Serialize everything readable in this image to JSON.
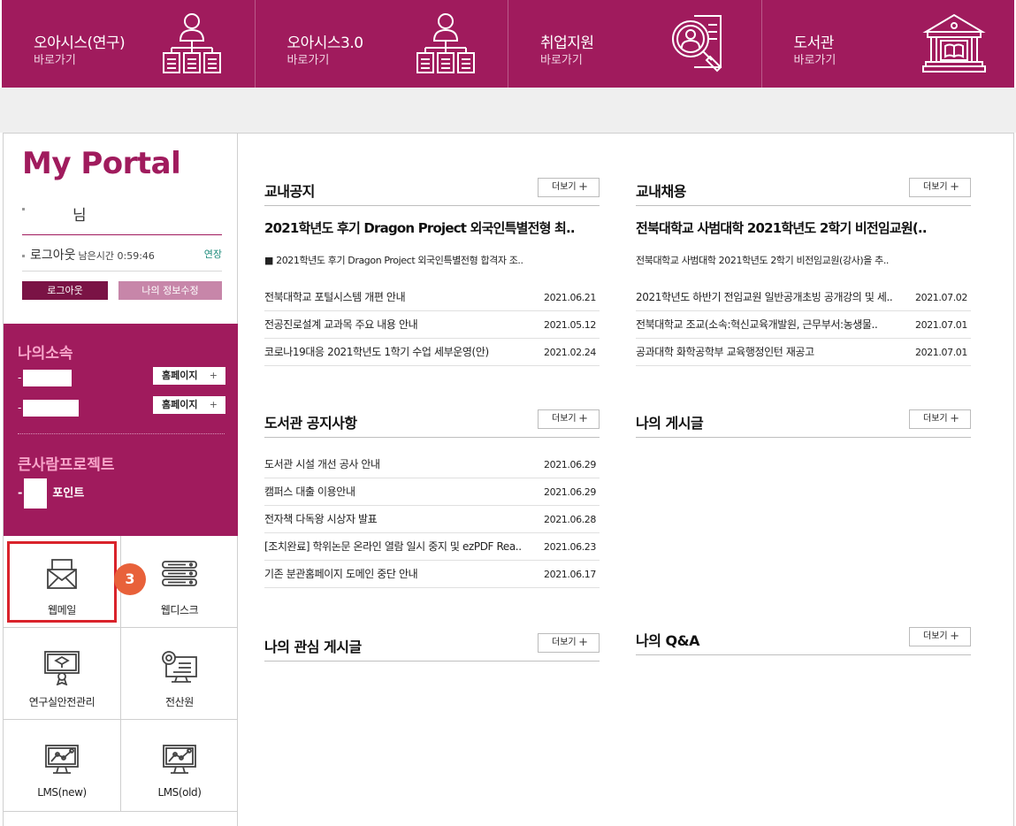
{
  "topbar": [
    {
      "title": "오아시스(연구)",
      "sub": "바로가기",
      "icon": "org-chart-icon"
    },
    {
      "title": "오아시스3.0",
      "sub": "바로가기",
      "icon": "org-chart-icon"
    },
    {
      "title": "취업지원",
      "sub": "바로가기",
      "icon": "job-search-icon"
    },
    {
      "title": "도서관",
      "sub": "바로가기",
      "icon": "library-icon"
    }
  ],
  "portal": {
    "title": "My Portal",
    "user_suffix": "님",
    "logout_label": "로그아웃",
    "remaining": "남은시간 0:59:46",
    "extend": "연장",
    "logout_button": "로그아웃",
    "info_button": "나의 정보수정"
  },
  "affiliation": {
    "title": "나의소속",
    "homepage_label": "홈페이지",
    "plus": "+",
    "project_title": "큰사람프로젝트",
    "point_label": "포인트"
  },
  "shortcuts": [
    {
      "label": "웹메일",
      "icon": "envelope-icon"
    },
    {
      "label": "웹디스크",
      "icon": "server-stack-icon"
    },
    {
      "label": "연구실안전관리",
      "icon": "certificate-monitor-icon"
    },
    {
      "label": "전산원",
      "icon": "gear-monitor-icon"
    },
    {
      "label": "LMS(new)",
      "icon": "chart-monitor-icon"
    },
    {
      "label": "LMS(old)",
      "icon": "chart-monitor-icon"
    }
  ],
  "annotation_badge": "3",
  "more_label": "더보기",
  "blocks": {
    "notice": {
      "title": "교내공지",
      "headline": "2021학년도 후기 Dragon Project 외국인특별전형 최..",
      "summary": "■ 2021학년도 후기 Dragon Project 외국인특별전형 합격자 조..",
      "items": [
        {
          "text": "전북대학교 포털시스템 개편 안내",
          "date": "2021.06.21"
        },
        {
          "text": "전공진로설계 교과목 주요 내용 안내",
          "date": "2021.05.12"
        },
        {
          "text": "코로나19대응 2021학년도 1학기 수업 세부운영(안)",
          "date": "2021.02.24"
        }
      ]
    },
    "hiring": {
      "title": "교내채용",
      "headline": "전북대학교 사범대학 2021학년도 2학기 비전임교원(..",
      "summary": "전북대학교 사범대학 2021학년도 2학기 비전임교원(강사)을 추..",
      "items": [
        {
          "text": "2021학년도 하반기 전임교원 일반공개초빙 공개강의 및 세..",
          "date": "2021.07.02"
        },
        {
          "text": "전북대학교 조교(소속:혁신교육개발원, 근무부서:농생물..",
          "date": "2021.07.01"
        },
        {
          "text": "공과대학 화학공학부 교육행정인턴 재공고",
          "date": "2021.07.01"
        }
      ]
    },
    "library": {
      "title": "도서관 공지사항",
      "items": [
        {
          "text": "도서관 시설 개선 공사 안내",
          "date": "2021.06.29"
        },
        {
          "text": "캠퍼스 대출 이용안내",
          "date": "2021.06.29"
        },
        {
          "text": "전자책 다독왕 시상자 발표",
          "date": "2021.06.28"
        },
        {
          "text": "[조치완료] 학위논문 온라인 열람 일시 중지 및 ezPDF Rea..",
          "date": "2021.06.23"
        },
        {
          "text": "기존 분관홈페이지 도메인 중단 안내",
          "date": "2021.06.17"
        }
      ]
    },
    "myposts": {
      "title": "나의 게시글"
    },
    "interest": {
      "title": "나의 관심 게시글"
    },
    "qa": {
      "title": "나의 Q&A"
    }
  }
}
